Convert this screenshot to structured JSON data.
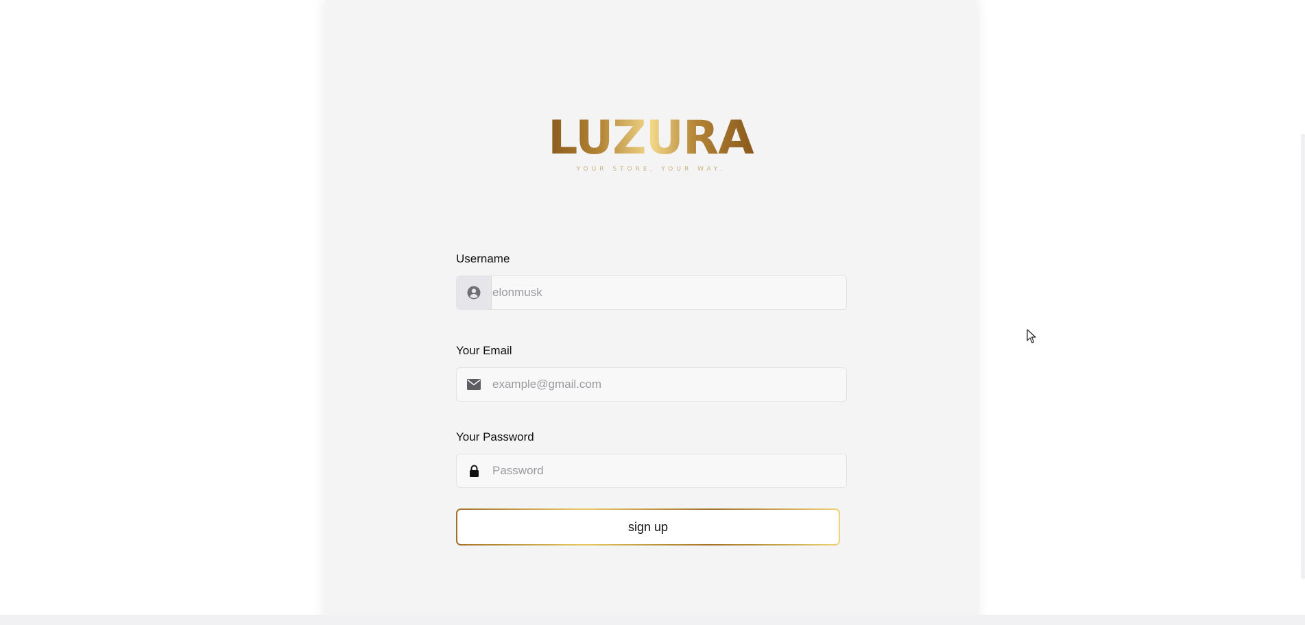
{
  "brand": {
    "logo_text": "LUZURA",
    "tagline": "YOUR STORE, YOUR WAY."
  },
  "form": {
    "username": {
      "label": "Username",
      "placeholder": "elonmusk",
      "icon": "user-circle-icon"
    },
    "email": {
      "label": "Your Email",
      "placeholder": "example@gmail.com",
      "icon": "envelope-icon"
    },
    "password": {
      "label": "Your Password",
      "placeholder": "Password",
      "icon": "lock-icon"
    },
    "submit_label": "sign up"
  },
  "colors": {
    "gold_dark": "#8a5a1c",
    "gold_light": "#f2d889",
    "panel_bg": "#f4f4f5"
  }
}
